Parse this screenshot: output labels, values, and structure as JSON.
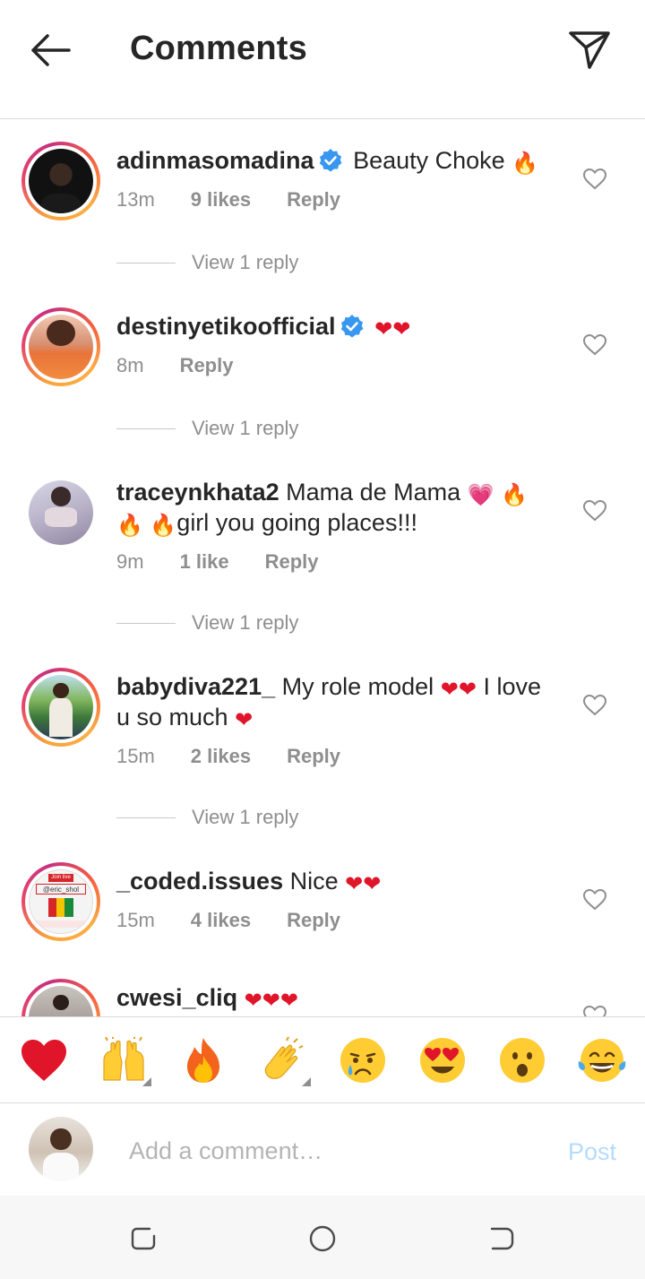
{
  "header": {
    "title": "Comments"
  },
  "comments": [
    {
      "username": "adinmasomadina",
      "verified": true,
      "text": "Beauty Choke",
      "time": "13m",
      "likes": "9 likes",
      "reply": "Reply",
      "view_replies": "View 1 reply"
    },
    {
      "username": "destinyetikoofficial",
      "verified": true,
      "text": "",
      "time": "8m",
      "likes": "",
      "reply": "Reply",
      "view_replies": "View 1 reply"
    },
    {
      "username": "traceynkhata2",
      "verified": false,
      "text_part1": "Mama de Mama",
      "text_part2": "girl you going places!!!",
      "time": "9m",
      "likes": "1 like",
      "reply": "Reply",
      "view_replies": "View 1 reply"
    },
    {
      "username": "babydiva221_",
      "verified": false,
      "text_part1": "My role model",
      "text_part2": "I love u so much",
      "time": "15m",
      "likes": "2 likes",
      "reply": "Reply",
      "view_replies": "View 1 reply"
    },
    {
      "username": "_coded.issues",
      "verified": false,
      "text": "Nice",
      "time": "15m",
      "likes": "4 likes",
      "reply": "Reply",
      "avatar_text_1": "Join live",
      "avatar_text_2": "@eric_shol"
    },
    {
      "username": "cwesi_cliq",
      "verified": false,
      "text": ""
    }
  ],
  "emoji_bar": [
    "heart",
    "raising-hands",
    "fire",
    "clapping-hands",
    "crying-face",
    "heart-eyes",
    "astonished-face",
    "tears-of-joy"
  ],
  "composer": {
    "placeholder": "Add a comment…",
    "post_label": "Post"
  },
  "colors": {
    "accent_blue": "#3897f0",
    "post_disabled": "#b3dbff",
    "heart_red": "#e0152a",
    "meta_gray": "#8e8e8e"
  }
}
